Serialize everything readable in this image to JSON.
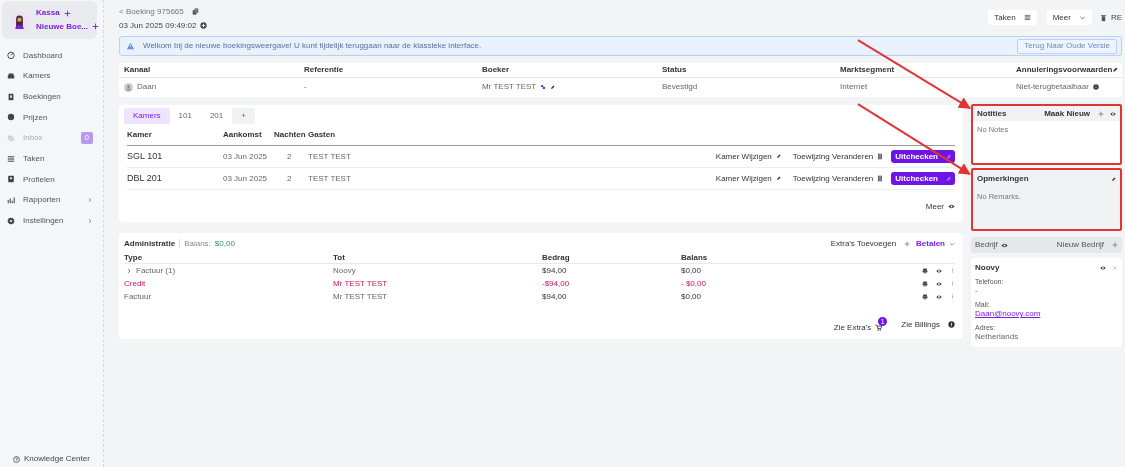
{
  "sidebar": {
    "user_actions": [
      "Kassa",
      "Nieuwe Boe..."
    ],
    "items": [
      {
        "label": "Dashboard",
        "disabled": false,
        "expandable": false
      },
      {
        "label": "Kamers",
        "disabled": false,
        "expandable": false
      },
      {
        "label": "Boekingen",
        "disabled": false,
        "expandable": false
      },
      {
        "label": "Prijzen",
        "disabled": false,
        "expandable": false
      },
      {
        "label": "Inbox",
        "disabled": true,
        "expandable": false,
        "badge": "0"
      },
      {
        "label": "Taken",
        "disabled": false,
        "expandable": false
      },
      {
        "label": "Profielen",
        "disabled": false,
        "expandable": false
      },
      {
        "label": "Rapporten",
        "disabled": false,
        "expandable": true
      },
      {
        "label": "Instellingen",
        "disabled": false,
        "expandable": true
      }
    ],
    "footer": "Knowledge Center"
  },
  "header": {
    "breadcrumb": "< Boeking 975665",
    "timestamp": "03 Jun 2025 09:49:02",
    "buttons": [
      "Taken",
      "Meer"
    ],
    "user_label": "RE"
  },
  "alert": {
    "message": "Welkom bij de nieuwe boekingsweergave! U kunt tijdelijk teruggaan naar de klassieke interface.",
    "button": "Terug Naar Oude Versie"
  },
  "booking_info": {
    "columns": [
      "Kanaal",
      "Referentie",
      "Boeker",
      "Status",
      "Marktsegment",
      "Annuleringsvoorwaarden"
    ],
    "row": [
      "Daan",
      "-",
      "Mr TEST TEST",
      "Bevestigd",
      "Internet",
      "Niet-terugbetaalbaar"
    ]
  },
  "rooms": {
    "tabs": [
      {
        "label": "Kamers",
        "selected": true
      },
      {
        "label": "101",
        "selected": false
      },
      {
        "label": "201",
        "selected": false
      },
      {
        "label": "+",
        "selected": false
      }
    ],
    "columns": [
      "Kamer",
      "Aankomst",
      "Nachten",
      "Gasten"
    ],
    "rows": [
      {
        "room": "SGL 101",
        "arrival": "03 Jun 2025",
        "nights": "2",
        "guests": "TEST TEST",
        "change": "Kamer Wijzigen",
        "reassign": "Toewijzing Veranderen",
        "checkout": "Uitchecken"
      },
      {
        "room": "DBL 201",
        "arrival": "03 Jun 2025",
        "nights": "2",
        "guests": "TEST TEST",
        "change": "Kamer Wijzigen",
        "reassign": "Toewijzing Veranderen",
        "checkout": "Uitchecken"
      }
    ],
    "more": "Meer"
  },
  "administration": {
    "title": "Administratie",
    "balance_label": "Balans:",
    "balance": "$0,00",
    "add_extras": "Extra's Toevoegen",
    "pay": "Betalen",
    "columns": [
      "Type",
      "Tot",
      "Bedrag",
      "Balans"
    ],
    "rows": [
      {
        "kind": "group",
        "type": "Factuur (1)",
        "to": "Noovy",
        "amount": "$94,00",
        "balance": "$0,00"
      },
      {
        "kind": "credit",
        "type": "Credit",
        "to": "Mr TEST TEST",
        "amount": "-$94,00",
        "balance": "- $0,00"
      },
      {
        "kind": "invoice",
        "type": "Factuur",
        "to": "Mr TEST TEST",
        "amount": "$94,00",
        "balance": "$0,00"
      }
    ],
    "see_extras": "Zie Extra's",
    "extras_count": "1",
    "see_billings": "Zie Billings"
  },
  "notes": {
    "title": "Notities",
    "action": "Maak Nieuw",
    "empty": "No Notes",
    "highlighted": true
  },
  "remarks": {
    "title": "Opmerkingen",
    "empty": "No Remarks.",
    "highlighted": true
  },
  "company": {
    "title": "Bedrijf",
    "action": "Nieuw Bedrijf",
    "name": "Noovy",
    "fields": [
      {
        "label": "Telefoon:",
        "value": "-",
        "link": false
      },
      {
        "label": "Mail:",
        "value": "Daan@noovy.com",
        "link": true
      },
      {
        "label": "Adres:",
        "value": "Netherlands",
        "link": false
      }
    ]
  }
}
